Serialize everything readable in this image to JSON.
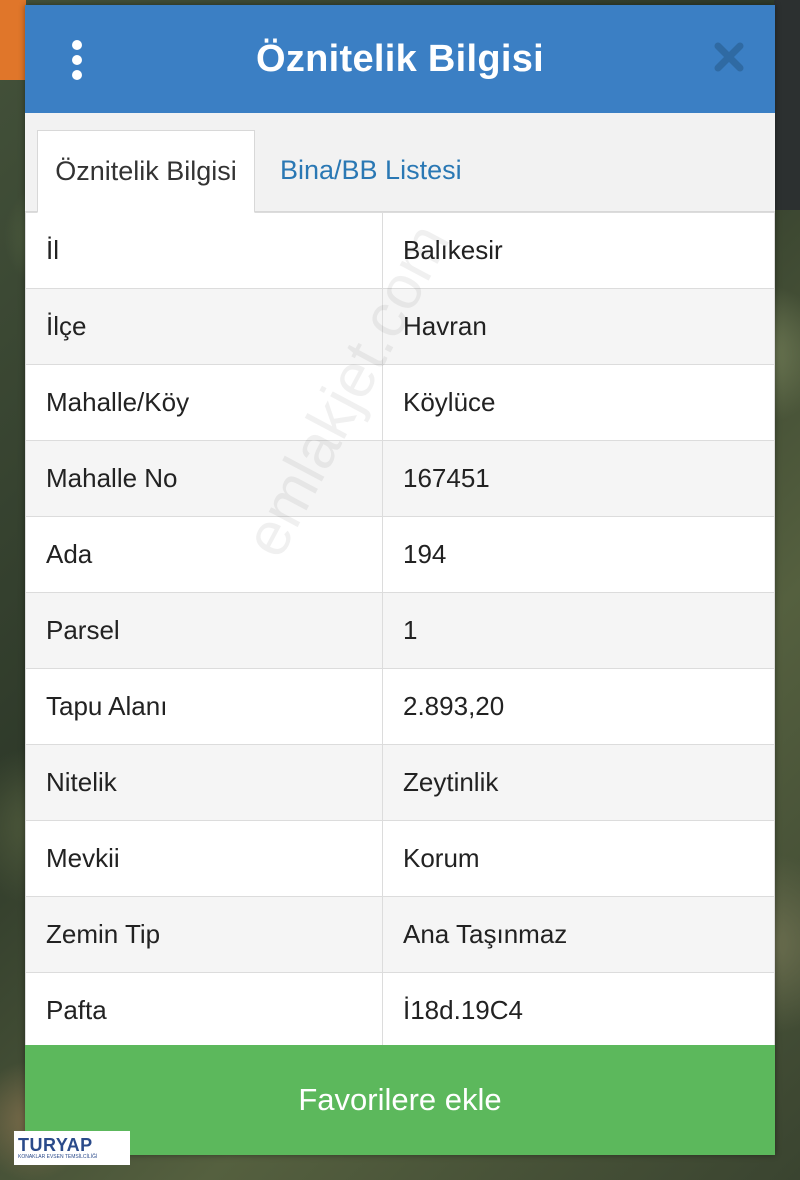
{
  "header": {
    "title": "Öznitelik Bilgisi",
    "menu_icon": "vertical-dots-icon",
    "close_icon": "close-icon"
  },
  "tabs": [
    {
      "label": "Öznitelik Bilgisi",
      "active": true
    },
    {
      "label": "Bina/BB Listesi",
      "active": false
    }
  ],
  "rows": [
    {
      "label": "İl",
      "value": "Balıkesir"
    },
    {
      "label": "İlçe",
      "value": "Havran"
    },
    {
      "label": "Mahalle/Köy",
      "value": "Köylüce"
    },
    {
      "label": "Mahalle No",
      "value": "167451"
    },
    {
      "label": "Ada",
      "value": "194"
    },
    {
      "label": "Parsel",
      "value": "1"
    },
    {
      "label": "Tapu Alanı",
      "value": "2.893,20"
    },
    {
      "label": "Nitelik",
      "value": "Zeytinlik"
    },
    {
      "label": "Mevkii",
      "value": "Korum"
    },
    {
      "label": "Zemin Tip",
      "value": "Ana Taşınmaz"
    },
    {
      "label": "Pafta",
      "value": "İ18d.19C4"
    }
  ],
  "favorite_button": "Favorilere ekle",
  "watermark": "emlakjet.com",
  "logo": {
    "name": "TURYAP",
    "subtitle": "KONAKLAR EVSEN TEMSİLCİLİĞİ"
  },
  "colors": {
    "header": "#3b7fc4",
    "tab_link": "#2a78b4",
    "favorite_button": "#5cb85c"
  }
}
